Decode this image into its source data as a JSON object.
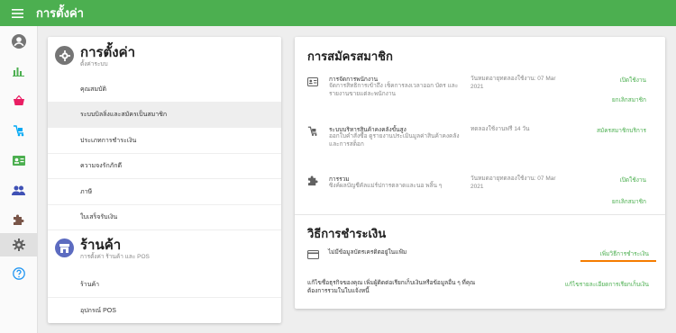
{
  "colors": {
    "topbar": "#4caf50",
    "accent_green": "#4caf50",
    "store_icon": "#5c6bc0",
    "highlight": "#f57c00"
  },
  "topbar": {
    "menu_icon": "hamburger-icon",
    "title": "การตั้งค่า"
  },
  "rail": {
    "items": [
      {
        "icon": "account-icon"
      },
      {
        "icon": "bar-chart-icon"
      },
      {
        "icon": "basket-icon"
      },
      {
        "icon": "trolley-icon"
      },
      {
        "icon": "id-card-icon"
      },
      {
        "icon": "people-icon"
      },
      {
        "icon": "puzzle-icon"
      },
      {
        "icon": "gear-icon",
        "active": true
      },
      {
        "icon": "help-icon"
      }
    ]
  },
  "left": {
    "settings": {
      "title": "การตั้งค่า",
      "subtitle": "ตั้งค่าระบบ",
      "items": [
        {
          "label": "คุณสมบัติ"
        },
        {
          "label": "ระบบบิลลิ่งและสมัครเป็นสมาชิก",
          "active": true
        },
        {
          "label": "ประเภทการชำระเงิน"
        },
        {
          "label": "ความจงรักภักดี"
        },
        {
          "label": "ภาษี"
        },
        {
          "label": "ใบเสร็จรับเงิน"
        }
      ]
    },
    "store": {
      "title": "ร้านค้า",
      "subtitle": "การตั้งค่า ร้านค้า และ POS",
      "items": [
        {
          "label": "ร้านค้า"
        },
        {
          "label": "อุปกรณ์ POS"
        }
      ]
    }
  },
  "membership": {
    "title": "การสมัครสมาชิก",
    "rows": [
      {
        "name": "การจัดการพนักงาน",
        "desc": "จัดการสิทธิการเข้าถึง เช็คการลงเวลาออก บัตร และรายงานขายแต่ละพนักงาน",
        "status": "วันหมดอายุทดลองใช้งาน: 07 Mar 2021",
        "actions": [
          "เปิดใช้งาน",
          "ยกเลิกสมาชิก"
        ]
      },
      {
        "name": "ระบบบริหารสินค้าคงคลังขั้นสูง",
        "desc": "ออกใบคำสั่งซื้อ ดูรายงานประเมินมูลค่าสินค้าคงคลัง และการสต็อก",
        "status": "ทดลองใช้งานฟรี 14 วัน",
        "actions": [
          "สมัครสมาชิกบริการ"
        ]
      },
      {
        "name": "การรวม",
        "desc": "ซิงค์ผลบัญชีคัลแม่ร์ปการตลาดและนอ พลิ้น ๆ",
        "status": "วันหมดอายุทดลองใช้งาน: 07 Mar 2021",
        "actions": [
          "เปิดใช้งาน",
          "ยกเลิกสมาชิก"
        ]
      }
    ]
  },
  "payment": {
    "title": "วิธีการชำระเงิน",
    "card_text": "ไม่มีข้อมูลบัตรเครดิตอยู่ในแฟ้ม",
    "add_link": "เพิ่มวิธีการชำระเงิน",
    "info_text": "แก้ไขชื่อธุรกิจของคุณ เพิ่มผู้ติดต่อเรียกเก็บเงินหรือข้อมูลอื่น ๆ ที่คุณต้องการรวมในใบแจ้งหนี้",
    "edit_link": "แก้ไขรายละเอียดการเรียกเก็บเงิน"
  }
}
